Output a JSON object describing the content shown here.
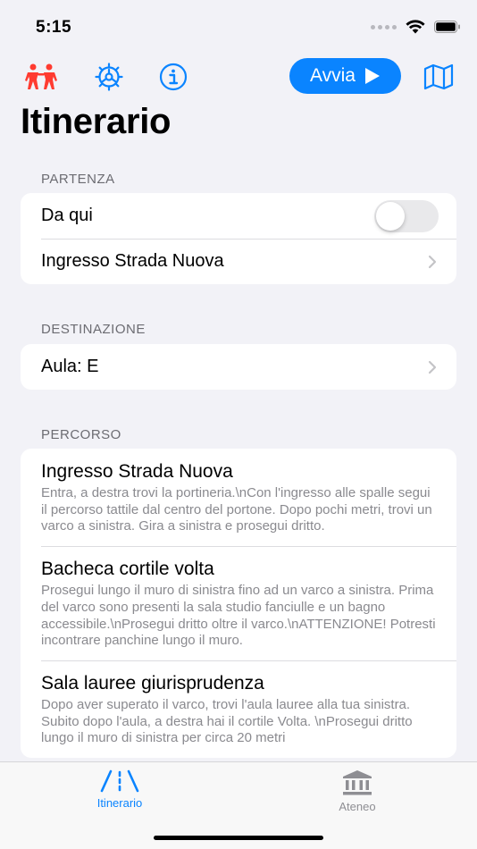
{
  "status": {
    "time": "5:15"
  },
  "toolbar": {
    "start_label": "Avvia"
  },
  "page": {
    "title": "Itinerario"
  },
  "sections": {
    "departure": {
      "header": "Partenza",
      "from_here_label": "Da qui",
      "from_here_on": false,
      "location": "Ingresso Strada Nuova"
    },
    "destination": {
      "header": "Destinazione",
      "value": "Aula: E"
    },
    "route": {
      "header": "Percorso",
      "steps": [
        {
          "title": "Ingresso Strada Nuova",
          "description": "Entra, a destra trovi la portineria.\\nCon l'ingresso alle spalle segui il percorso tattile dal centro del portone. Dopo pochi metri, trovi un varco a sinistra. Gira a sinistra e prosegui dritto."
        },
        {
          "title": "Bacheca cortile volta",
          "description": "Prosegui lungo il muro di sinistra fino ad un varco a sinistra. Prima del varco sono presenti la sala studio fanciulle e un bagno accessibile.\\nProsegui dritto oltre il varco.\\nATTENZIONE! Potresti incontrare panchine lungo il muro."
        },
        {
          "title": "Sala lauree giurisprudenza",
          "description": "Dopo aver superato il varco, trovi l'aula lauree alla tua sinistra. Subito dopo l'aula, a destra hai il cortile Volta. \\nProsegui dritto lungo il muro di sinistra per circa 20 metri"
        }
      ]
    }
  },
  "tabs": [
    {
      "label": "Itinerario",
      "active": true
    },
    {
      "label": "Ateneo",
      "active": false
    }
  ],
  "colors": {
    "accent": "#0a84ff",
    "people_icon": "#ff3b30",
    "background": "#f2f2f7",
    "secondary_text": "#8a8a8f",
    "inactive_tab": "#8e8e93"
  }
}
